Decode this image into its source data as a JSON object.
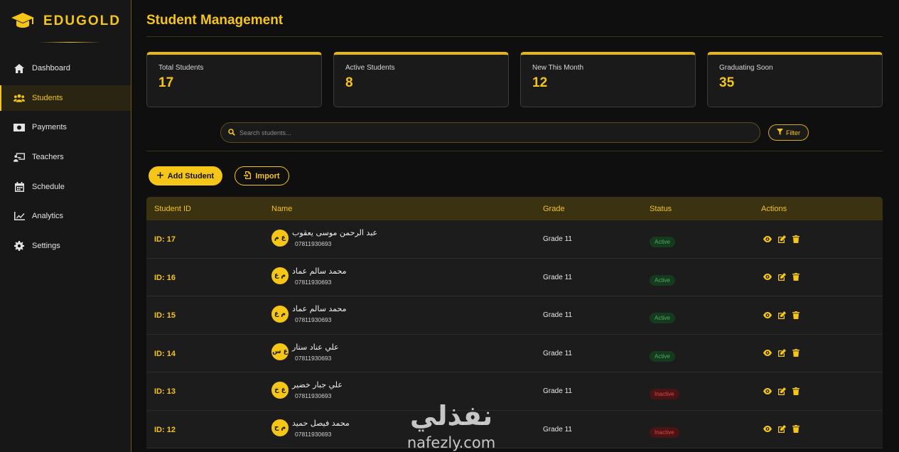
{
  "brand": {
    "name": "EDUGOLD"
  },
  "sidebar": {
    "items": [
      {
        "label": "Dashboard",
        "icon": "home-icon",
        "active": false
      },
      {
        "label": "Students",
        "icon": "users-icon",
        "active": true
      },
      {
        "label": "Payments",
        "icon": "money-icon",
        "active": false
      },
      {
        "label": "Teachers",
        "icon": "teacher-icon",
        "active": false
      },
      {
        "label": "Schedule",
        "icon": "calendar-icon",
        "active": false
      },
      {
        "label": "Analytics",
        "icon": "chart-line-icon",
        "active": false
      },
      {
        "label": "Settings",
        "icon": "gear-icon",
        "active": false
      }
    ]
  },
  "page": {
    "title": "Student Management"
  },
  "stats": [
    {
      "label": "Total Students",
      "value": "17"
    },
    {
      "label": "Active Students",
      "value": "8"
    },
    {
      "label": "New This Month",
      "value": "12"
    },
    {
      "label": "Graduating Soon",
      "value": "35"
    }
  ],
  "search": {
    "placeholder": "Search students...",
    "value": ""
  },
  "toolbar": {
    "filter_label": "Filter",
    "add_label": "Add Student",
    "import_label": "Import"
  },
  "table": {
    "headers": {
      "id": "Student ID",
      "name": "Name",
      "grade": "Grade",
      "status": "Status",
      "actions": "Actions"
    },
    "rows": [
      {
        "id": "ID: 17",
        "initials": "ع م",
        "name": "عبد الرحمن موسى يعقوب",
        "phone": "07811930693",
        "grade": "Grade 11",
        "status": "Active",
        "status_type": "active"
      },
      {
        "id": "ID: 16",
        "initials": "م ع",
        "name": "محمد سالم عماد",
        "phone": "07811930693",
        "grade": "Grade 11",
        "status": "Active",
        "status_type": "active"
      },
      {
        "id": "ID: 15",
        "initials": "م ع",
        "name": "محمد سالم عماد",
        "phone": "07811930693",
        "grade": "Grade 11",
        "status": "Active",
        "status_type": "active"
      },
      {
        "id": "ID: 14",
        "initials": "ع س",
        "name": "علي عناد ستار",
        "phone": "07811930693",
        "grade": "Grade 11",
        "status": "Active",
        "status_type": "active"
      },
      {
        "id": "ID: 13",
        "initials": "ع خ",
        "name": "علي جبار خضير",
        "phone": "07811930693",
        "grade": "Grade 11",
        "status": "Inactive",
        "status_type": "inactive"
      },
      {
        "id": "ID: 12",
        "initials": "م ح",
        "name": "محمد فيصل حميد",
        "phone": "07811930693",
        "grade": "Grade 11",
        "status": "Inactive",
        "status_type": "inactive"
      }
    ]
  },
  "watermark": {
    "arabic": "نفذلي",
    "latin": "nafezly.com"
  },
  "colors": {
    "accent": "#f5c518",
    "active": "#4fae5f",
    "inactive": "#e04848",
    "background": "#0f0f0f"
  }
}
